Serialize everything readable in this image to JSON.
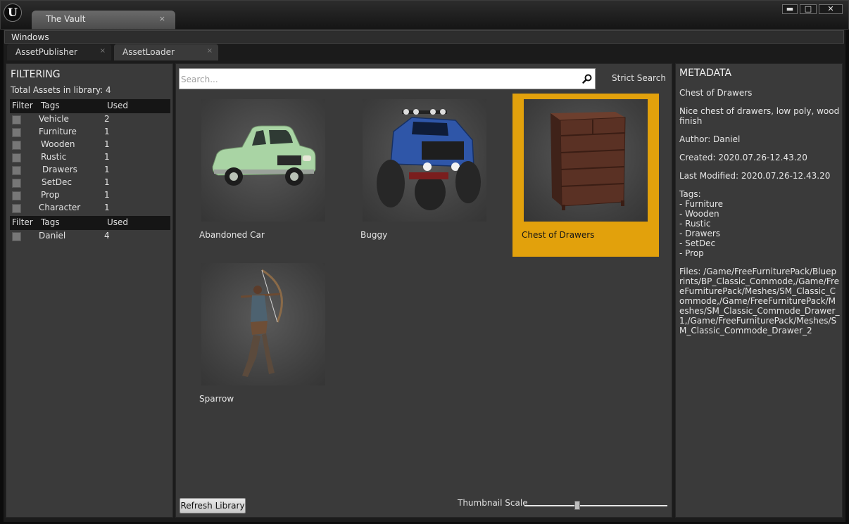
{
  "window": {
    "logo": "U",
    "tab_title": "The Vault",
    "tab_close": "×",
    "min_symbol": "▬",
    "max_symbol": "□",
    "close_symbol": "✕"
  },
  "menu": {
    "windows": "Windows"
  },
  "doc_tabs": [
    {
      "label": "AssetPublisher",
      "close": "×"
    },
    {
      "label": "AssetLoader",
      "close": "×",
      "active": true
    }
  ],
  "filtering": {
    "title": "FILTERING",
    "total": "Total Assets in library: 4",
    "tag_table": {
      "headers": [
        "Filter",
        "Tags",
        "Used"
      ],
      "rows": [
        {
          "tag": "Vehicle",
          "used": "2"
        },
        {
          "tag": "Furniture",
          "used": "1"
        },
        {
          "tag": "Wooden",
          "used": "1"
        },
        {
          "tag": "Rustic",
          "used": "1"
        },
        {
          "tag": "Drawers",
          "used": "1"
        },
        {
          "tag": "SetDec",
          "used": "1"
        },
        {
          "tag": "Prop",
          "used": "1"
        },
        {
          "tag": "Character",
          "used": "1"
        }
      ]
    },
    "author_table": {
      "headers": [
        "Filter",
        "Tags",
        "Used"
      ],
      "rows": [
        {
          "tag": "Daniel",
          "used": "4"
        }
      ]
    }
  },
  "search": {
    "placeholder": "Search...",
    "icon": "search-icon",
    "strict_label": "Strict Search"
  },
  "assets": [
    {
      "name": "Abandoned Car",
      "selected": false
    },
    {
      "name": "Buggy",
      "selected": false
    },
    {
      "name": "Chest of Drawers",
      "selected": true
    },
    {
      "name": "Sparrow",
      "selected": false
    }
  ],
  "footer": {
    "refresh_label": "Refresh Library",
    "scale_label": "Thumbnail Scale",
    "scale_value": 0.37
  },
  "metadata": {
    "title": "METADATA",
    "name": "Chest of Drawers",
    "description": "Nice chest of drawers, low poly, wood finish",
    "author": "Author: Daniel",
    "created": "Created: 2020.07.26-12.43.20",
    "modified": "Last Modified: 2020.07.26-12.43.20",
    "tags_header": "Tags:",
    "tags": [
      "- Furniture",
      "- Wooden",
      "- Rustic",
      "- Drawers",
      "- SetDec",
      "- Prop"
    ],
    "files": "Files: /Game/FreeFurniturePack/Blueprints/BP_Classic_Commode,/Game/FreeFurniturePack/Meshes/SM_Classic_Commode,/Game/FreeFurniturePack/Meshes/SM_Classic_Commode_Drawer_1,/Game/FreeFurniturePack/Meshes/SM_Classic_Commode_Drawer_2"
  },
  "colors": {
    "selection": "#e2a10c",
    "panel": "#3a3a3a",
    "background": "#1b1b1b"
  }
}
